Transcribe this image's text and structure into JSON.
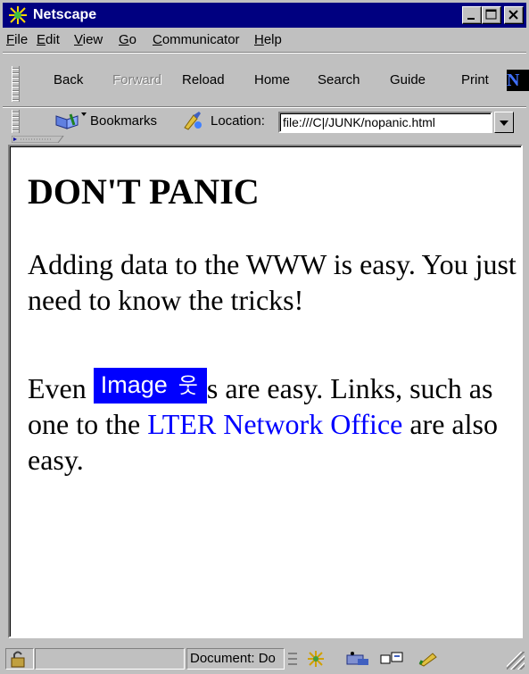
{
  "window": {
    "title": "Netscape"
  },
  "menu": [
    "File",
    "Edit",
    "View",
    "Go",
    "Communicator",
    "Help"
  ],
  "menu_underline": [
    "F",
    "E",
    "V",
    "G",
    "C",
    "H"
  ],
  "nav": {
    "back": "Back",
    "forward": "Forward",
    "reload": "Reload",
    "home": "Home",
    "search": "Search",
    "guide": "Guide",
    "print": "Print",
    "logo_letter": "N"
  },
  "location_bar": {
    "bookmarks_label": "Bookmarks",
    "location_label": "Location:",
    "url": "file:///C|/JUNK/nopanic.html"
  },
  "page": {
    "heading": "DON'T PANIC",
    "para1": "Adding data to the WWW is easy. You just need to know the tricks!",
    "para2_prefix": "Even ",
    "image_label": "Image",
    "image_figure": "웃",
    "para2_after_image": "s are easy. Links, such as one to the ",
    "link_text": "LTER Network Office",
    "para2_suffix": " are also easy."
  },
  "status": {
    "document": "Document: Do"
  },
  "colors": {
    "titlebar": "#000080",
    "chrome": "#c0c0c0",
    "link": "#0000ff",
    "image_bg": "#0000ff"
  }
}
